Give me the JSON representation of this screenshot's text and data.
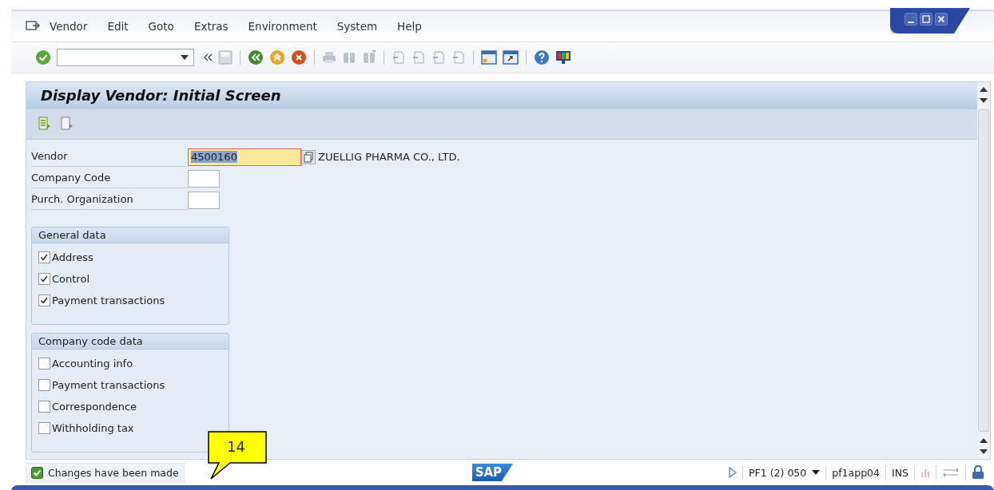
{
  "menu": [
    {
      "label": "Vendor"
    },
    {
      "label": "Edit"
    },
    {
      "label": "Goto"
    },
    {
      "label": "Extras"
    },
    {
      "label": "Environment"
    },
    {
      "label": "System"
    },
    {
      "label": "Help"
    }
  ],
  "title": "Display Vendor:  Initial Screen",
  "fields": [
    {
      "label": "Vendor",
      "value": "4500160",
      "kind": "required",
      "description": "ZUELLIG PHARMA CO., LTD."
    },
    {
      "label": "Company Code",
      "kind": "short"
    },
    {
      "label": "Purch. Organization",
      "kind": "short"
    }
  ],
  "groups": [
    {
      "title": "General data",
      "items": [
        {
          "label": "Address",
          "checked": true
        },
        {
          "label": "Control",
          "checked": true
        },
        {
          "label": "Payment transactions",
          "checked": true
        }
      ]
    },
    {
      "title": "Company code data",
      "items": [
        {
          "label": "Accounting info",
          "checked": false
        },
        {
          "label": "Payment transactions",
          "checked": false
        },
        {
          "label": "Correspondence",
          "checked": false
        },
        {
          "label": "Withholding tax",
          "checked": false
        }
      ]
    }
  ],
  "status_bar": {
    "message": "Changes have been made",
    "logo": "SAP",
    "system": "PF1 (2) 050",
    "server": "pf1app04",
    "mode": "INS"
  },
  "callout": {
    "label": "14"
  }
}
